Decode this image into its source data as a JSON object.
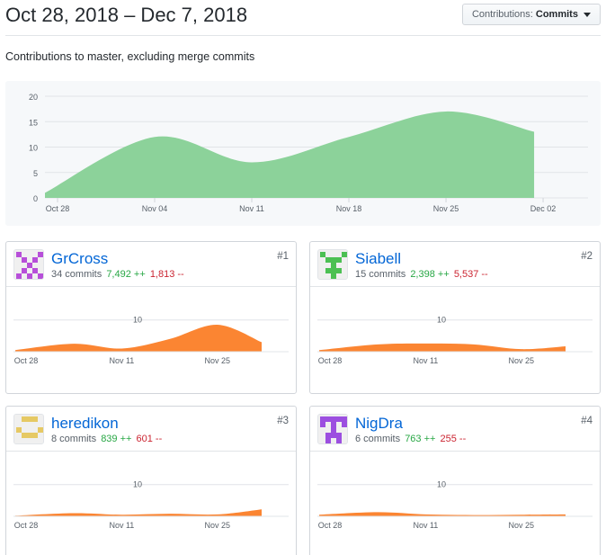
{
  "header": {
    "title": "Oct 28, 2018 – Dec 7, 2018",
    "dropdown_prefix": "Contributions:",
    "dropdown_value": "Commits"
  },
  "subtitle": "Contributions to master, excluding merge commits",
  "chart_data": [
    {
      "type": "area",
      "x": [
        "2018-10-28",
        "2018-11-04",
        "2018-11-11",
        "2018-11-18",
        "2018-11-25",
        "2018-12-02"
      ],
      "x_tick_labels": [
        "Oct 28",
        "Nov 04",
        "Nov 11",
        "Nov 18",
        "Nov 25",
        "Dec 02"
      ],
      "series": [
        {
          "values": [
            1,
            12,
            7,
            12,
            17,
            13
          ]
        }
      ],
      "ylim": [
        0,
        20
      ],
      "y_ticks": [
        0,
        5,
        10,
        15,
        20
      ],
      "grid": true,
      "color": "#8cd29a"
    },
    {
      "type": "area",
      "x": [
        "2018-10-28",
        "2018-11-04",
        "2018-11-11",
        "2018-11-18",
        "2018-11-25",
        "2018-12-02"
      ],
      "x_tick_labels": [
        "Oct 28",
        "Nov 11",
        "Nov 25"
      ],
      "series": [
        {
          "name": "GrCross",
          "values": [
            0.5,
            2.5,
            1,
            4,
            8.5,
            3
          ]
        }
      ],
      "ylim": [
        0,
        17
      ],
      "y_ticks": [
        10
      ],
      "color": "#fb8532"
    },
    {
      "type": "area",
      "x": [
        "2018-10-28",
        "2018-11-04",
        "2018-11-11",
        "2018-11-18",
        "2018-11-25",
        "2018-12-02"
      ],
      "x_tick_labels": [
        "Oct 28",
        "Nov 11",
        "Nov 25"
      ],
      "series": [
        {
          "name": "Siabell",
          "values": [
            0.5,
            2.3,
            2.6,
            2.3,
            0.8,
            1.7
          ]
        }
      ],
      "ylim": [
        0,
        17
      ],
      "y_ticks": [
        10
      ],
      "color": "#fb8532"
    },
    {
      "type": "area",
      "x": [
        "2018-10-28",
        "2018-11-04",
        "2018-11-11",
        "2018-11-18",
        "2018-11-25",
        "2018-12-02"
      ],
      "x_tick_labels": [
        "Oct 28",
        "Nov 11",
        "Nov 25"
      ],
      "series": [
        {
          "name": "heredikon",
          "values": [
            0.2,
            1,
            0.5,
            0.8,
            0.6,
            2.2
          ]
        }
      ],
      "ylim": [
        0,
        17
      ],
      "y_ticks": [
        10
      ],
      "color": "#fb8532"
    },
    {
      "type": "area",
      "x": [
        "2018-10-28",
        "2018-11-04",
        "2018-11-11",
        "2018-11-18",
        "2018-11-25",
        "2018-12-02"
      ],
      "x_tick_labels": [
        "Oct 28",
        "Nov 11",
        "Nov 25"
      ],
      "series": [
        {
          "name": "NigDra",
          "values": [
            0.5,
            1.3,
            0.6,
            0.4,
            0.5,
            0.6
          ]
        }
      ],
      "ylim": [
        0,
        17
      ],
      "y_ticks": [
        10
      ],
      "color": "#fb8532"
    }
  ],
  "contributors": [
    {
      "name": "GrCross",
      "commits": "34 commits",
      "additions": "7,492 ++",
      "deletions": "1,813 --",
      "rank": "#1",
      "avatar_color": "#b74fd9",
      "avatar_bg": "#f0f0f0"
    },
    {
      "name": "Siabell",
      "commits": "15 commits",
      "additions": "2,398 ++",
      "deletions": "5,537 --",
      "rank": "#2",
      "avatar_color": "#4cc053",
      "avatar_bg": "#f0f0f0"
    },
    {
      "name": "heredikon",
      "commits": "8 commits",
      "additions": "839 ++",
      "deletions": "601 --",
      "rank": "#3",
      "avatar_color": "#e6c964",
      "avatar_bg": "#f0f0f0"
    },
    {
      "name": "NigDra",
      "commits": "6 commits",
      "additions": "763 ++",
      "deletions": "255 --",
      "rank": "#4",
      "avatar_color": "#9c4fe0",
      "avatar_bg": "#f0f0f0"
    }
  ],
  "colors": {
    "link": "#0366d6",
    "addition": "#28a745",
    "deletion": "#cb2431",
    "main_area": "#8cd29a",
    "mini_area": "#fb8532"
  }
}
